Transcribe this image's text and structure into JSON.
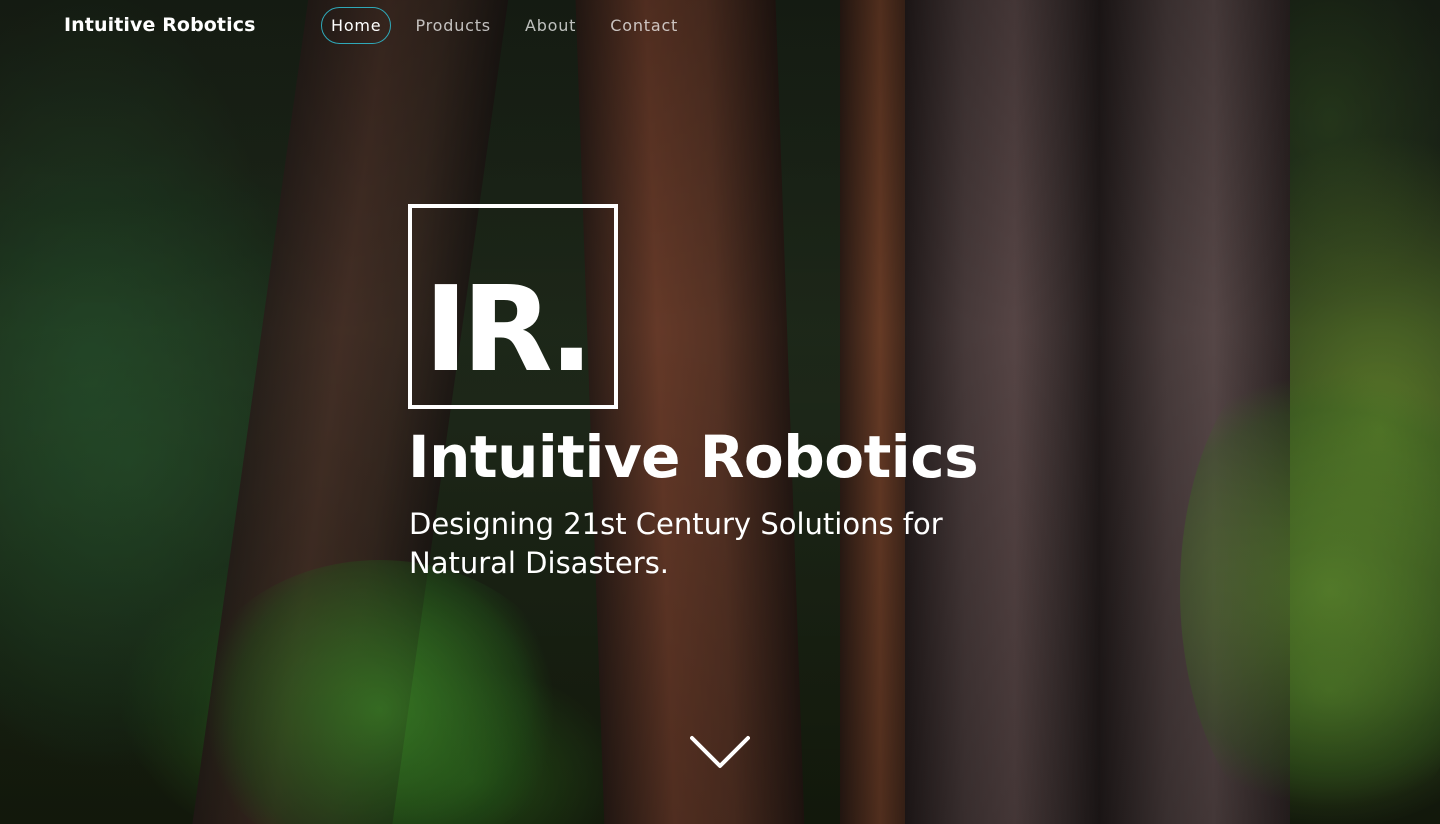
{
  "nav": {
    "brand": "Intuitive Robotics",
    "items": [
      {
        "label": "Home",
        "active": true
      },
      {
        "label": "Products",
        "active": false
      },
      {
        "label": "About",
        "active": false
      },
      {
        "label": "Contact",
        "active": false
      }
    ]
  },
  "hero": {
    "logo_text": "IR.",
    "title": "Intuitive Robotics",
    "subtitle": "Designing 21st Century Solutions for Natural Disasters.",
    "scroll_icon": "chevron-down-icon"
  },
  "colors": {
    "active_nav_border": "#2fa8b8",
    "text": "#ffffff"
  }
}
